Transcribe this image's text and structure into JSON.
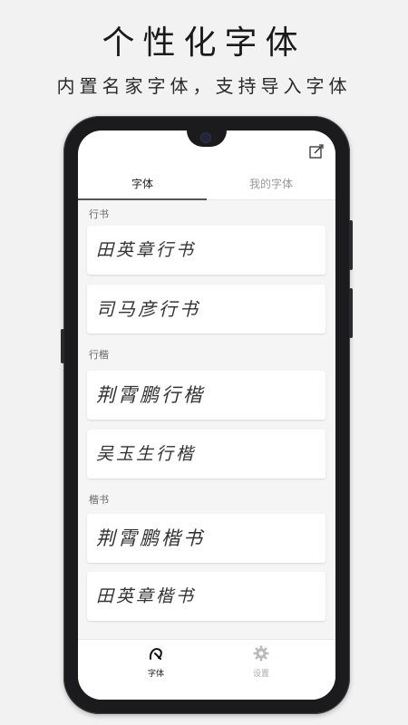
{
  "promo": {
    "title": "个性化字体",
    "subtitle": "内置名家字体，支持导入字体"
  },
  "app": {
    "tabs": [
      {
        "label": "字体",
        "active": true
      },
      {
        "label": "我的字体",
        "active": false
      }
    ],
    "header_icon": "edit-icon",
    "sections": [
      {
        "label": "行书",
        "fonts": [
          "田英章行书",
          "司马彦行书"
        ]
      },
      {
        "label": "行楷",
        "fonts": [
          "荆霄鹏行楷",
          "吴玉生行楷"
        ]
      },
      {
        "label": "楷书",
        "fonts": [
          "荆霄鹏楷书",
          "田英章楷书"
        ]
      }
    ],
    "bottom_nav": [
      {
        "label": "字体",
        "icon": "font-icon",
        "active": true
      },
      {
        "label": "设置",
        "icon": "gear-icon",
        "active": false
      }
    ]
  },
  "colors": {
    "background": "#f3f2f3",
    "phone": "#1b1b1d",
    "active_text": "#222222",
    "inactive_text": "#999999"
  }
}
